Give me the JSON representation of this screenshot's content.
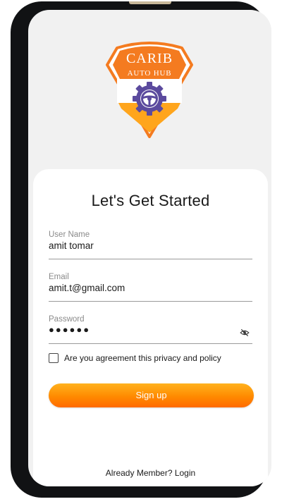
{
  "logo": {
    "line1": "CARIB",
    "line2": "AUTO HUB",
    "colors": {
      "orange": "#f47b20",
      "gold": "#ffa51c",
      "purple": "#5b4a9e"
    }
  },
  "form": {
    "title": "Let's Get Started",
    "username": {
      "label": "User Name",
      "value": "amit tomar"
    },
    "email": {
      "label": "Email",
      "value": "amit.t@gmail.com"
    },
    "password": {
      "label": "Password",
      "value": "●●●●●●",
      "toggle_icon": "eye-off-icon"
    },
    "agreement_label": "Are you agreement this privacy and policy",
    "agreement_checked": false,
    "signup_label": "Sign up",
    "login_prompt": "Already Member? Login"
  },
  "colors": {
    "accent_start": "#ffb21e",
    "accent_end": "#ff6a00",
    "screen_bg": "#f1f1f1",
    "card_bg": "#ffffff"
  }
}
